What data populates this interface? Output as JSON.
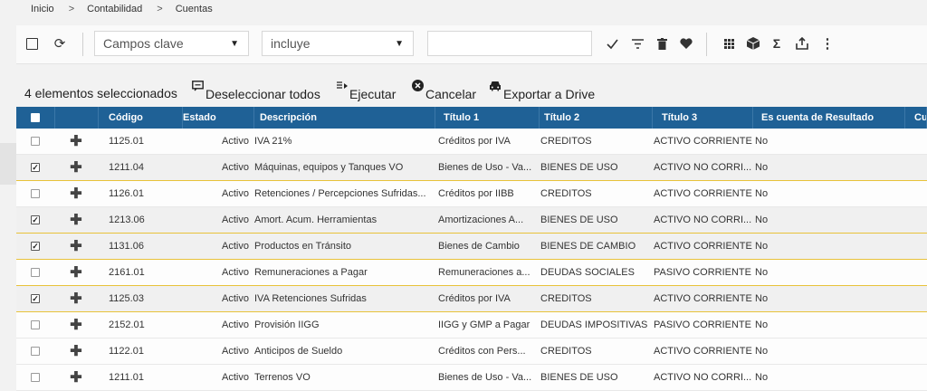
{
  "breadcrumb": [
    "Inicio",
    "Contabilidad",
    "Cuentas"
  ],
  "breadcrumb_separator": ">",
  "toolbar": {
    "field_select": "Campos clave",
    "operator_select": "incluye",
    "search_value": "",
    "refresh_glyph": "⟳",
    "icons": [
      "check-icon",
      "filter-icon",
      "trash-icon",
      "heart-icon",
      "grid-icon",
      "cube-icon",
      "sigma-icon",
      "share-icon",
      "more-vert-icon"
    ]
  },
  "actions": {
    "selected_count": "4 elementos seleccionados",
    "deselect": "Deseleccionar todos",
    "execute": "Ejecutar",
    "cancel": "Cancelar",
    "export": "Exportar a Drive"
  },
  "table": {
    "columns": [
      "Código",
      "Estado",
      "Descripción",
      "Título 1",
      "Título 2",
      "Título 3",
      "Es cuenta de Resultado",
      "Cuent"
    ],
    "rows": [
      {
        "checked": false,
        "codigo": "1125.01",
        "estado": "Activo",
        "descripcion": "IVA 21%",
        "titulo1": "Créditos por IVA",
        "titulo2": "CREDITOS",
        "titulo3": "ACTIVO CORRIENTE",
        "resultado": "No"
      },
      {
        "checked": true,
        "codigo": "1211.04",
        "estado": "Activo",
        "descripcion": "Máquinas, equipos y Tanques VO",
        "titulo1": "Bienes de Uso - Va...",
        "titulo2": "BIENES DE USO",
        "titulo3": "ACTIVO NO CORRI...",
        "resultado": "No"
      },
      {
        "checked": false,
        "codigo": "1126.01",
        "estado": "Activo",
        "descripcion": "Retenciones / Percepciones Sufridas...",
        "titulo1": "Créditos por IIBB",
        "titulo2": "CREDITOS",
        "titulo3": "ACTIVO CORRIENTE",
        "resultado": "No"
      },
      {
        "checked": true,
        "codigo": "1213.06",
        "estado": "Activo",
        "descripcion": "Amort. Acum. Herramientas",
        "titulo1": "Amortizaciones A...",
        "titulo2": "BIENES DE USO",
        "titulo3": "ACTIVO NO CORRI...",
        "resultado": "No"
      },
      {
        "checked": true,
        "codigo": "1131.06",
        "estado": "Activo",
        "descripcion": "Productos en Tránsito",
        "titulo1": "Bienes de Cambio",
        "titulo2": "BIENES DE CAMBIO",
        "titulo3": "ACTIVO CORRIENTE",
        "resultado": "No"
      },
      {
        "checked": false,
        "codigo": "2161.01",
        "estado": "Activo",
        "descripcion": "Remuneraciones a Pagar",
        "titulo1": "Remuneraciones a...",
        "titulo2": "DEUDAS SOCIALES",
        "titulo3": "PASIVO CORRIENTE",
        "resultado": "No"
      },
      {
        "checked": true,
        "codigo": "1125.03",
        "estado": "Activo",
        "descripcion": "IVA Retenciones Sufridas",
        "titulo1": "Créditos por IVA",
        "titulo2": "CREDITOS",
        "titulo3": "ACTIVO CORRIENTE",
        "resultado": "No"
      },
      {
        "checked": false,
        "codigo": "2152.01",
        "estado": "Activo",
        "descripcion": "Provisión IIGG",
        "titulo1": "IIGG y GMP a Pagar",
        "titulo2": "DEUDAS IMPOSITIVAS",
        "titulo3": "PASIVO CORRIENTE",
        "resultado": "No"
      },
      {
        "checked": false,
        "codigo": "1122.01",
        "estado": "Activo",
        "descripcion": "Anticipos de Sueldo",
        "titulo1": "Créditos con Pers...",
        "titulo2": "CREDITOS",
        "titulo3": "ACTIVO CORRIENTE",
        "resultado": "No"
      },
      {
        "checked": false,
        "codigo": "1211.01",
        "estado": "Activo",
        "descripcion": "Terrenos VO",
        "titulo1": "Bienes de Uso - Va...",
        "titulo2": "BIENES DE USO",
        "titulo3": "ACTIVO NO CORRI...",
        "resultado": "No"
      }
    ]
  },
  "colors": {
    "header_bg": "#1f6196",
    "selected_row_border": "#e8c23a"
  }
}
